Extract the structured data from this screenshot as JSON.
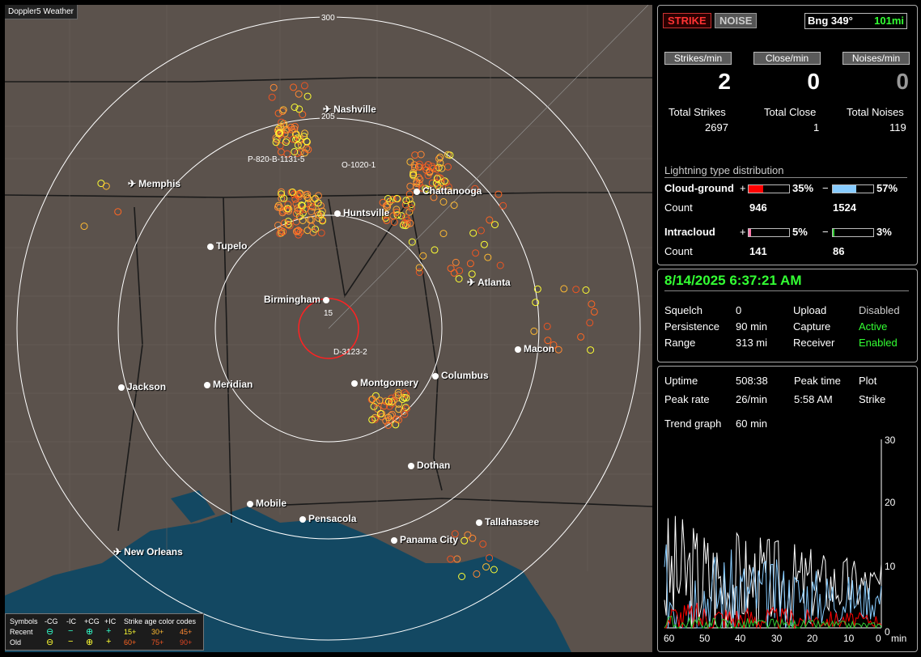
{
  "map": {
    "title": "Doppler5 Weather",
    "ring_labels": [
      "300",
      "205",
      "15"
    ],
    "cities": [
      {
        "name": "Nashville",
        "kind": "airport"
      },
      {
        "name": "Memphis",
        "kind": "airport"
      },
      {
        "name": "Chattanooga",
        "kind": "city"
      },
      {
        "name": "Huntsville",
        "kind": "city"
      },
      {
        "name": "Tupelo",
        "kind": "city"
      },
      {
        "name": "Atlanta",
        "kind": "airport"
      },
      {
        "name": "Birmingham",
        "kind": "city"
      },
      {
        "name": "Macon",
        "kind": "city"
      },
      {
        "name": "Jackson",
        "kind": "city"
      },
      {
        "name": "Meridian",
        "kind": "city"
      },
      {
        "name": "Montgomery",
        "kind": "city"
      },
      {
        "name": "Columbus",
        "kind": "city"
      },
      {
        "name": "Dothan",
        "kind": "city"
      },
      {
        "name": "Mobile",
        "kind": "city"
      },
      {
        "name": "Pensacola",
        "kind": "city"
      },
      {
        "name": "Tallahassee",
        "kind": "city"
      },
      {
        "name": "Panama City",
        "kind": "city"
      },
      {
        "name": "New Orleans",
        "kind": "airport"
      }
    ],
    "noise_labels": [
      "P-820-B-1131-5",
      "O-1020-1",
      "D-3123-2"
    ]
  },
  "legend": {
    "symbols": "Symbols",
    "headers": [
      "-CG",
      "-IC",
      "+CG",
      "+IC"
    ],
    "age_title": "Strike age color codes",
    "recent": "Recent",
    "old": "Old",
    "recent_ages": [
      "15+",
      "30+",
      "45+"
    ],
    "old_ages": [
      "60+",
      "75+",
      "90+"
    ]
  },
  "top": {
    "strike_btn": "STRIKE",
    "noise_btn": "NOISE",
    "bearing": "Bng 349°",
    "distance": "101mi",
    "strikes_min_label": "Strikes/min",
    "close_min_label": "Close/min",
    "noises_min_label": "Noises/min",
    "strikes_min": "2",
    "close_min": "0",
    "noises_min": "0",
    "total_strikes_label": "Total Strikes",
    "total_close_label": "Total Close",
    "total_noises_label": "Total Noises",
    "total_strikes": "2697",
    "total_close": "1",
    "total_noises": "119",
    "dist_title": "Lightning type distribution",
    "cg_label": "Cloud-ground",
    "ic_label": "Intracloud",
    "count_label": "Count",
    "plus": "+",
    "minus": "−",
    "cg_pos_pct": "35%",
    "cg_neg_pct": "57%",
    "cg_pos_count": "946",
    "cg_neg_count": "1524",
    "ic_pos_pct": "5%",
    "ic_neg_pct": "3%",
    "ic_pos_count": "141",
    "ic_neg_count": "86"
  },
  "status": {
    "datetime": "8/14/2025 6:37:21 AM",
    "squelch_label": "Squelch",
    "squelch": "0",
    "persistence_label": "Persistence",
    "persistence": "90 min",
    "range_label": "Range",
    "range": "313 mi",
    "upload_label": "Upload",
    "upload": "Disabled",
    "capture_label": "Capture",
    "capture": "Active",
    "receiver_label": "Receiver",
    "receiver": "Enabled"
  },
  "trend": {
    "uptime_label": "Uptime",
    "uptime": "508:38",
    "peak_time_label": "Peak time",
    "peak_time": "5:58 AM",
    "plot_label": "Plot",
    "peak_rate_label": "Peak rate",
    "peak_rate": "26/min",
    "plot_mode": "Strike",
    "trend_label": "Trend graph",
    "trend_window": "60 min",
    "y_ticks": [
      "30",
      "20",
      "10",
      "0"
    ],
    "x_ticks": [
      "60",
      "50",
      "40",
      "30",
      "20",
      "10",
      "0"
    ],
    "x_unit": "min"
  },
  "colors": {
    "recent_15": "#ffff33",
    "recent_30": "#ffbb33",
    "recent_45": "#ff8833",
    "old_60": "#ff6622",
    "old_75": "#ee5522",
    "old_90": "#dd4422",
    "cg_pos": "#ff0000",
    "cg_neg": "#88ccff",
    "ic_pos": "#ff77aa",
    "ic_neg": "#33cc33",
    "accent_green": "#33ff33"
  }
}
